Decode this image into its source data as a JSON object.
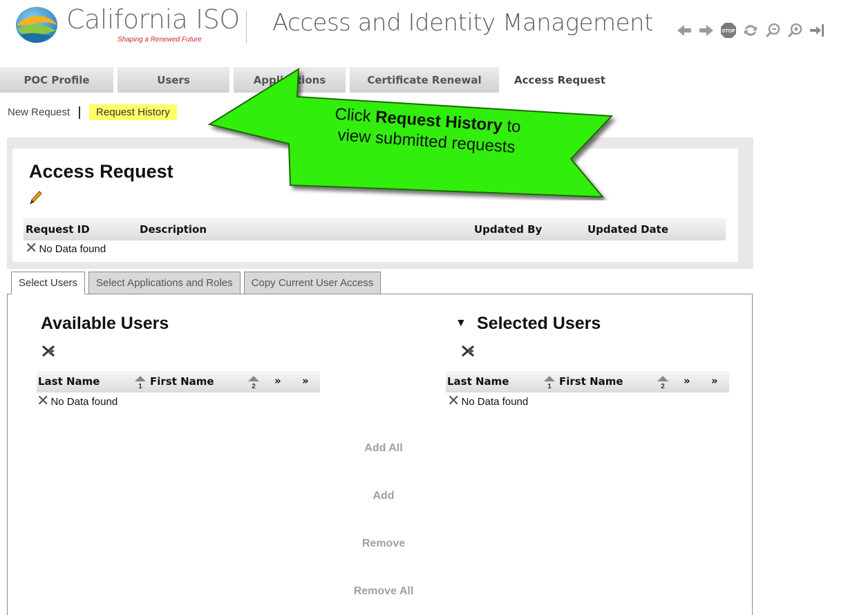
{
  "header": {
    "logo_text": "California ISO",
    "logo_tagline": "Shaping a Renewed Future",
    "app_title": "Access and Identity Management",
    "toolbar_icons": [
      "arrow-left-icon",
      "arrow-right-icon",
      "stop-icon",
      "refresh-icon",
      "zoom-out-icon",
      "zoom-in-icon",
      "logout-icon"
    ],
    "stop_label": "STOP"
  },
  "main_tabs": [
    {
      "label": "POC Profile",
      "active": false
    },
    {
      "label": "Users",
      "active": false
    },
    {
      "label": "Applications",
      "active": false
    },
    {
      "label": "Certificate Renewal",
      "active": false
    },
    {
      "label": "Access Request",
      "active": true
    }
  ],
  "subnav": {
    "new_request": "New Request",
    "request_history": "Request History"
  },
  "callout": {
    "line1_prefix": "Click ",
    "line1_bold": "Request History",
    "line1_suffix": " to",
    "line2": "view submitted requests",
    "color": "#33ee11"
  },
  "request_panel": {
    "title": "Access Request",
    "columns": [
      "Request ID",
      "Description",
      "Updated By",
      "Updated Date"
    ],
    "empty_text": "No Data found"
  },
  "sub_tabs": [
    {
      "label": "Select Users",
      "active": true
    },
    {
      "label": "Select Applications and Roles",
      "active": false
    },
    {
      "label": "Copy Current User Access",
      "active": false
    }
  ],
  "available_users": {
    "title": "Available Users",
    "columns": [
      "Last Name",
      "First Name"
    ],
    "sort_badges": [
      "1",
      "2"
    ],
    "empty_text": "No Data found"
  },
  "selected_users": {
    "title": "Selected Users",
    "columns": [
      "Last Name",
      "First Name"
    ],
    "sort_badges": [
      "1",
      "2"
    ],
    "empty_text": "No Data found"
  },
  "move_buttons": {
    "add_all": "Add All",
    "add": "Add",
    "remove": "Remove",
    "remove_all": "Remove All"
  }
}
